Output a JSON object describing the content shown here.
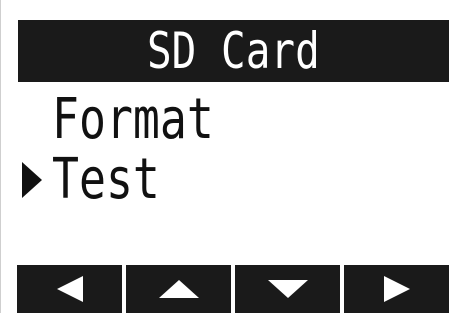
{
  "screen": {
    "title": "SD Card",
    "menu": {
      "items": [
        {
          "label": "Format",
          "selected": false
        },
        {
          "label": "Test",
          "selected": true
        }
      ],
      "cursor_icon": "triangle-right-icon"
    },
    "softkeys": [
      {
        "icon": "arrow-left-icon"
      },
      {
        "icon": "arrow-up-icon"
      },
      {
        "icon": "arrow-down-icon"
      },
      {
        "icon": "arrow-right-icon"
      }
    ]
  },
  "colors": {
    "background": "#ffffff",
    "bar": "#1a1a1a",
    "text": "#111111",
    "inverse_text": "#ffffff"
  }
}
